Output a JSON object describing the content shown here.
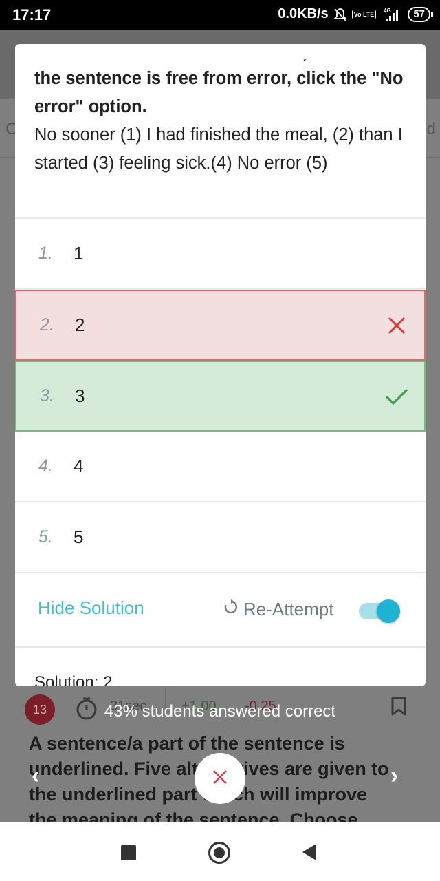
{
  "status_bar": {
    "time": "17:17",
    "network_speed": "0.0KB/s",
    "volte_label": "Vo LTE",
    "network_type": "4G",
    "battery": "57"
  },
  "background": {
    "question_number": "13",
    "time_taken": "31sec",
    "positive_marks": "+1.00",
    "negative_marks": "-0.25",
    "question_text": "A sentence/a part of the sentence is underlined. Five alternatives are given to the underlined part which will improve the meaning of the sentence. Choose",
    "toast": "43% students answered correct",
    "prev_glyph": "‹",
    "next_glyph": "›",
    "edge_left": "C",
    "edge_right": "d"
  },
  "dialog": {
    "question_cut_line": "If the sentence is free from error, click the",
    "question_instruction": "the sentence is free from error, click the \"No error\" option.",
    "question_body": "No sooner (1) I had finished the meal, (2) than I started (3) feeling sick.(4) No error (5)",
    "options": [
      {
        "num": "1.",
        "value": "1",
        "state": "normal"
      },
      {
        "num": "2.",
        "value": "2",
        "state": "wrong"
      },
      {
        "num": "3.",
        "value": "3",
        "state": "correct"
      },
      {
        "num": "4.",
        "value": "4",
        "state": "normal"
      },
      {
        "num": "5.",
        "value": "5",
        "state": "normal"
      }
    ],
    "hide_solution_label": "Hide Solution",
    "reattempt_label": "Re-Attempt",
    "reattempt_toggle_on": true,
    "solution_label": "Solution: 2"
  },
  "colors": {
    "accent": "#3fbfd2",
    "toggle": "#1fb3d3",
    "wrong_bg": "#f3dfdf",
    "wrong_border": "#de6b6b",
    "wrong_mark": "#d93b3b",
    "correct_bg": "#d6ead8",
    "correct_border": "#76b97c",
    "correct_mark": "#3fa14f"
  },
  "icons": [
    "mute-icon",
    "signal-icon",
    "battery-icon",
    "timer-icon",
    "bookmark-icon",
    "close-icon",
    "cross-icon",
    "check-icon",
    "refresh-icon"
  ]
}
